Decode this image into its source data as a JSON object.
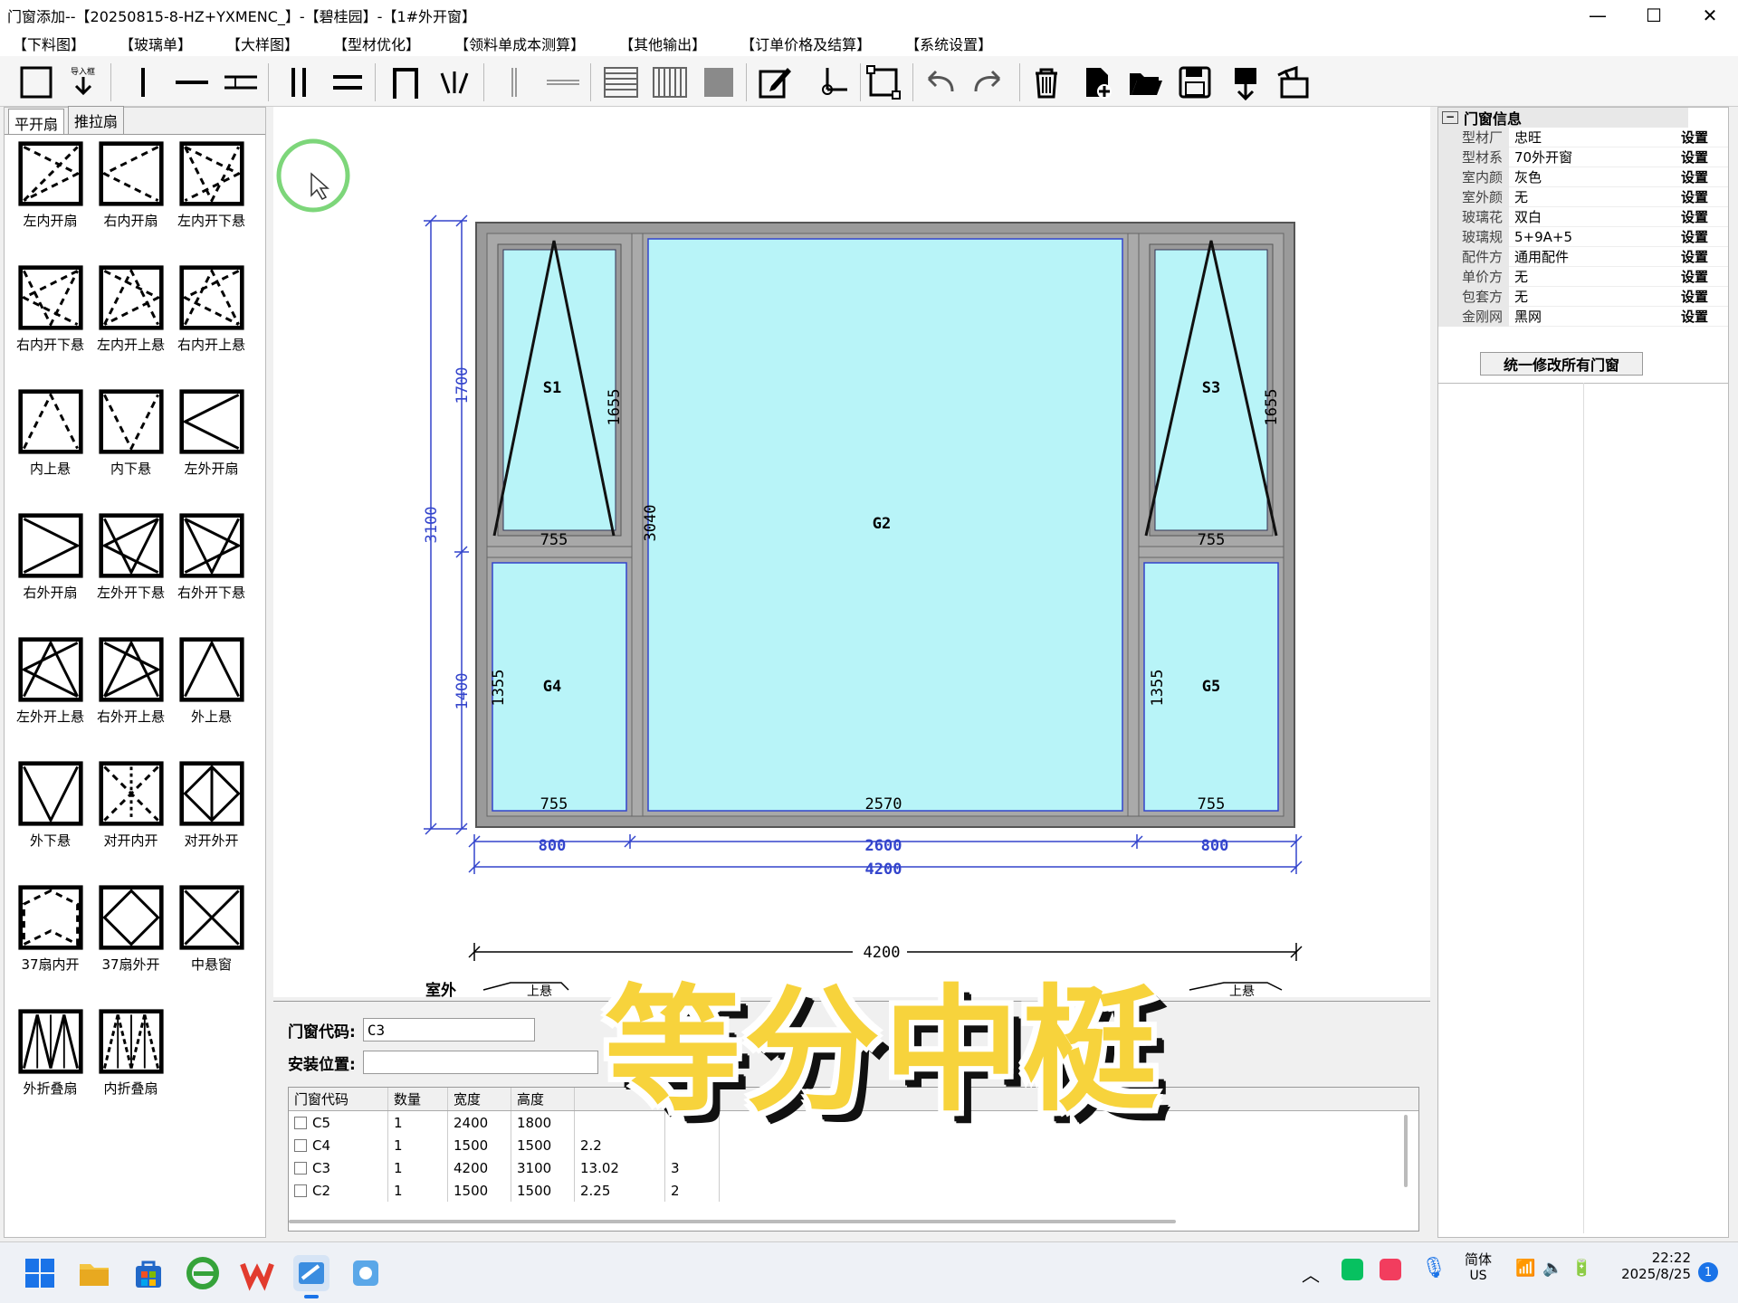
{
  "window": {
    "title": "门窗添加--【20250815-8-HZ+YXMENC_】-【碧桂园】-【1#外开窗】",
    "minimize": "—",
    "maximize": "☐",
    "close": "✕"
  },
  "menu": [
    "【下料图】",
    "【玻璃单】",
    "【大样图】",
    "【型材优化】",
    "【领料单成本测算】",
    "【其他输出】",
    "【订单价格及结算】",
    "【系统设置】"
  ],
  "toolbar": {
    "icons": [
      "frame-icon",
      "import-frame-icon",
      "vertical-mullion-icon",
      "horizontal-mullion-icon",
      "transom-icon",
      "double-vertical-icon",
      "double-horizontal-icon",
      "door-frame-icon",
      "fan-divider-icon",
      "thin-vertical-icon",
      "thin-horizontal-icon",
      "horizontal-louver-icon",
      "vertical-louver-icon",
      "fill-icon",
      "edit-icon",
      "corner-icon",
      "select-frame-icon",
      "undo-icon",
      "redo-icon",
      "delete-icon",
      "new-file-icon",
      "open-folder-icon",
      "save-icon",
      "export-icon",
      "exit-icon"
    ],
    "import_label": "导入框"
  },
  "left_panel": {
    "tabs": [
      "平开扇",
      "推拉扇"
    ],
    "active_tab": "平开扇",
    "sashes": [
      "左内开扇",
      "右内开扇",
      "左内开下悬",
      "右内开下悬",
      "左内开上悬",
      "右内开上悬",
      "内上悬",
      "内下悬",
      "左外开扇",
      "右外开扇",
      "左外开下悬",
      "右外开下悬",
      "左外开上悬",
      "右外开上悬",
      "外上悬",
      "外下悬",
      "对开内开",
      "对开外开",
      "37扇内开",
      "37扇外开",
      "中悬窗",
      "外折叠扇",
      "内折叠扇"
    ]
  },
  "drawing": {
    "panes": {
      "S1": "S1",
      "S3": "S3",
      "G2": "G2",
      "G4": "G4",
      "G5": "G5"
    },
    "dims": {
      "left_total": "3100",
      "left_top": "1700",
      "left_bottom": "1400",
      "s1_height": "1655",
      "s3_height": "1655",
      "center_height": "3040",
      "g4_height": "1355",
      "g5_height": "1355",
      "s1_width": "755",
      "s3_width": "755",
      "g4_width": "755",
      "g5_width": "755",
      "g2_width": "2570",
      "bottom_left": "800",
      "bottom_center": "2600",
      "bottom_right": "800",
      "bottom_total": "4200",
      "section_total": "4200"
    },
    "section_labels": {
      "outside": "室外",
      "top": "上悬"
    }
  },
  "door_info": {
    "header": "门窗信息",
    "rows": [
      {
        "key": "型材厂家",
        "value": "忠旺",
        "btn": "设置"
      },
      {
        "key": "型材系列",
        "value": "70外开窗",
        "btn": "设置"
      },
      {
        "key": "室内颜色",
        "value": "灰色",
        "btn": "设置"
      },
      {
        "key": "室外颜色",
        "value": "无",
        "btn": "设置"
      },
      {
        "key": "玻璃花色",
        "value": "双白",
        "btn": "设置"
      },
      {
        "key": "玻璃规格",
        "value": "5+9A+5",
        "btn": "设置"
      },
      {
        "key": "配件方案",
        "value": "通用配件",
        "btn": "设置"
      },
      {
        "key": "单价方案",
        "value": "无",
        "btn": "设置"
      },
      {
        "key": "包套方案",
        "value": "无",
        "btn": "设置"
      },
      {
        "key": "金刚网",
        "value": "黑网",
        "btn": "设置"
      }
    ],
    "unify_button": "统一修改所有门窗"
  },
  "form": {
    "code_label": "门窗代码:",
    "code_value": "C3",
    "position_label": "安装位置:",
    "position_value": ""
  },
  "table": {
    "headers": [
      "门窗代码",
      "数量",
      "宽度",
      "高度"
    ],
    "rows": [
      {
        "code": "C5",
        "qty": "1",
        "w": "2400",
        "h": "1800",
        "area": "",
        "n": ""
      },
      {
        "code": "C4",
        "qty": "1",
        "w": "1500",
        "h": "1500",
        "area": "2.2",
        "n": ""
      },
      {
        "code": "C3",
        "qty": "1",
        "w": "4200",
        "h": "3100",
        "area": "13.02",
        "n": "3"
      },
      {
        "code": "C2",
        "qty": "1",
        "w": "1500",
        "h": "1500",
        "area": "2.25",
        "n": "2"
      }
    ]
  },
  "overlay_caption": "等分中梃",
  "taskbar": {
    "ime_top": "简体",
    "ime_bottom": "US",
    "time": "22:22",
    "date": "2025/8/25",
    "notif": "1"
  }
}
